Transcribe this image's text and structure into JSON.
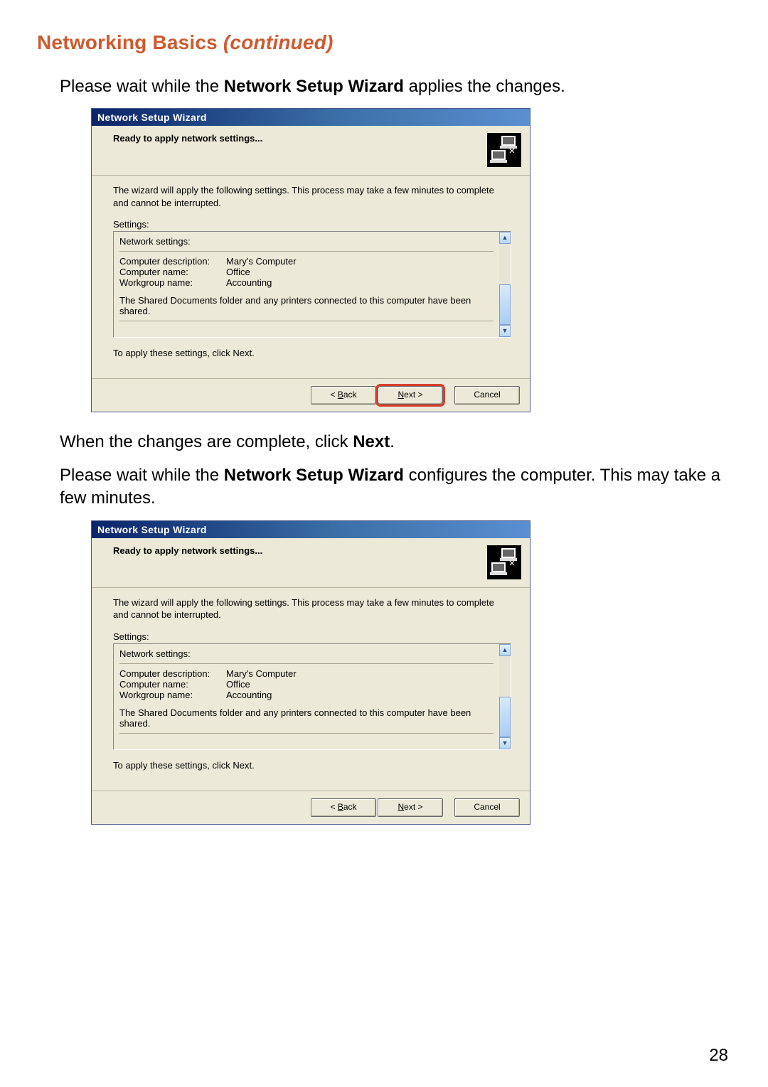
{
  "page": {
    "section_title_main": "Networking Basics ",
    "section_title_em": "(continued)",
    "page_number": "28"
  },
  "lines": {
    "intro1_pre": "Please wait while the ",
    "intro1_bold": "Network Setup Wizard",
    "intro1_post": " applies the changes.",
    "mid1_pre": "When the changes are complete, click ",
    "mid1_bold": "Next",
    "mid1_post": ".",
    "mid2_pre": "Please wait while the ",
    "mid2_bold": "Network Setup Wizard",
    "mid2_post": " configures the computer. This may take a few minutes."
  },
  "wizard": {
    "title": "Network Setup Wizard",
    "header_title": "Ready to apply network settings...",
    "body_intro": "The wizard will apply the following settings. This process may take a few minutes to complete and cannot be interrupted.",
    "settings_label": "Settings:",
    "settings_heading": "Network settings:",
    "desc_label": "Computer description:",
    "desc_value": "Mary's Computer",
    "name_label": "Computer name:",
    "name_value": "Office",
    "wg_label": "Workgroup name:",
    "wg_value": "Accounting",
    "shared_note": "The Shared Documents folder and any printers connected to this computer have been shared.",
    "apply_note": "To apply these settings, click Next.",
    "btn_back": "< Back",
    "btn_next": "Next >",
    "btn_cancel": "Cancel"
  }
}
